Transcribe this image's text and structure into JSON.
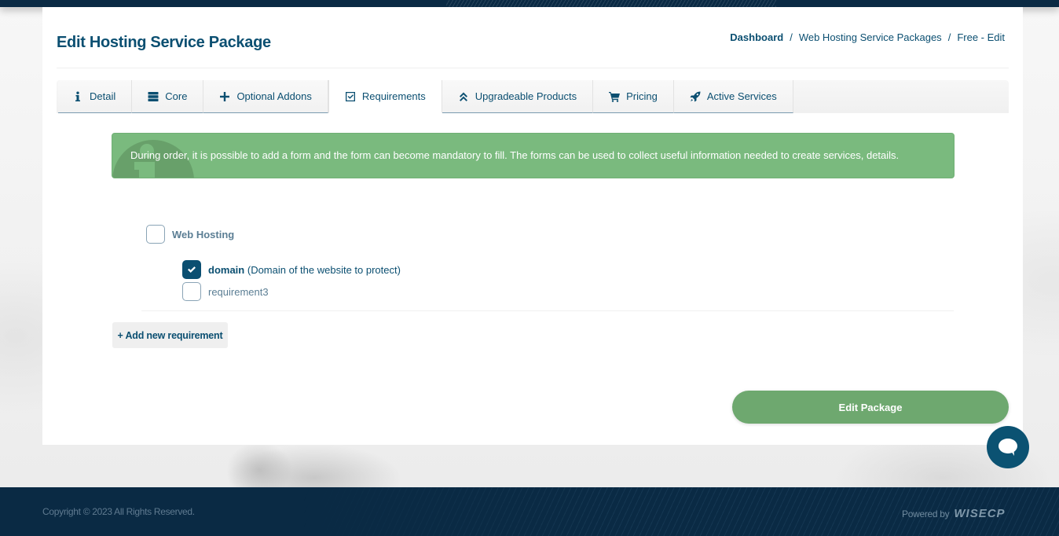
{
  "header": {
    "title": "Edit Hosting Service Package",
    "breadcrumb": [
      {
        "label": "Dashboard"
      },
      {
        "label": "Web Hosting Service Packages"
      },
      {
        "label": "Free - Edit"
      }
    ],
    "breadcrumb_separator": "/"
  },
  "tabs": [
    {
      "label": "Detail",
      "icon": "info-icon",
      "active": false
    },
    {
      "label": "Core",
      "icon": "server-icon",
      "active": false
    },
    {
      "label": "Optional Addons",
      "icon": "plus-icon",
      "active": false
    },
    {
      "label": "Requirements",
      "icon": "checkbox-icon",
      "active": true
    },
    {
      "label": "Upgradeable Products",
      "icon": "double-chevron-up-icon",
      "active": false
    },
    {
      "label": "Pricing",
      "icon": "cart-icon",
      "active": false
    },
    {
      "label": "Active Services",
      "icon": "rocket-icon",
      "active": false
    }
  ],
  "alert": {
    "icon": "info-icon",
    "text": "During order, it is possible to add a form and the form can become mandatory to fill. The forms can be used to collect useful information needed to create services, details.",
    "color": "#7aba7e"
  },
  "requirements": {
    "group": {
      "label": "Web Hosting",
      "checked": false
    },
    "items": [
      {
        "name": "domain",
        "description": "(Domain of the website to protect)",
        "checked": true
      },
      {
        "name": "requirement3",
        "description": "",
        "checked": false
      }
    ]
  },
  "buttons": {
    "add_requirement": "+ Add new requirement",
    "edit_package": "Edit Package"
  },
  "chat": {
    "icon": "chat-bubble-icon"
  },
  "footer": {
    "copyright": "Copyright © 2023 All Rights Reserved.",
    "powered_by": "Powered by",
    "brand": "WISECP"
  },
  "colors": {
    "primary": "#0b4f71",
    "navy": "#0a2a44",
    "success": "#6ea86f"
  }
}
